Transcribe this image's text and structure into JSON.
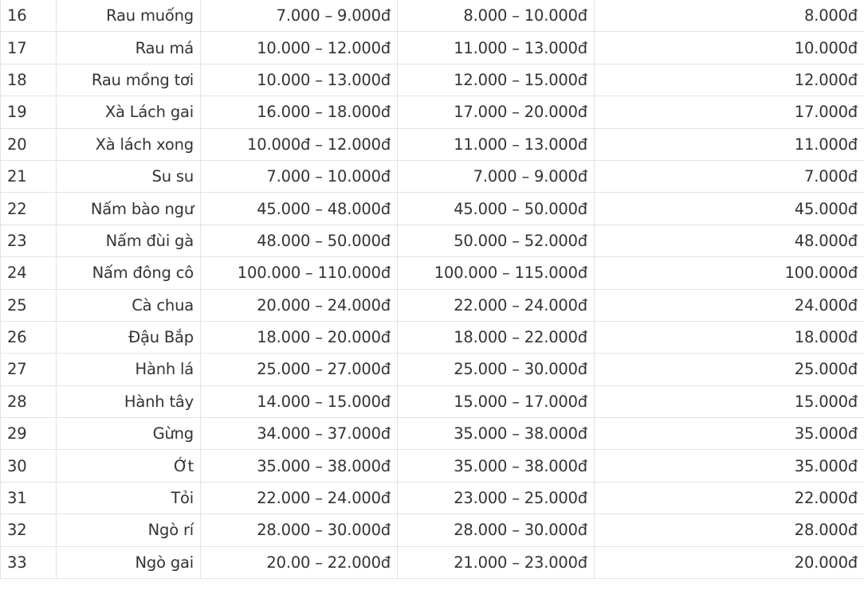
{
  "table": {
    "rows": [
      {
        "no": "16",
        "name": "Rau muống",
        "p1": "7.000 – 9.000đ",
        "p2": "8.000 – 10.000đ",
        "p3": "8.000đ"
      },
      {
        "no": "17",
        "name": "Rau má",
        "p1": "10.000 – 12.000đ",
        "p2": "11.000 – 13.000đ",
        "p3": "10.000đ"
      },
      {
        "no": "18",
        "name": "Rau mồng tơi",
        "p1": "10.000 – 13.000đ",
        "p2": "12.000 – 15.000đ",
        "p3": "12.000đ"
      },
      {
        "no": "19",
        "name": "Xà Lách gai",
        "p1": "16.000 – 18.000đ",
        "p2": "17.000 – 20.000đ",
        "p3": "17.000đ"
      },
      {
        "no": "20",
        "name": "Xà lách xong",
        "p1": "10.000đ – 12.000đ",
        "p2": "11.000 – 13.000đ",
        "p3": "11.000đ"
      },
      {
        "no": "21",
        "name": "Su su",
        "p1": "7.000 – 10.000đ",
        "p2": "7.000 – 9.000đ",
        "p3": "7.000đ"
      },
      {
        "no": "22",
        "name": "Nấm bào ngư",
        "p1": "45.000 – 48.000đ",
        "p2": "45.000 – 50.000đ",
        "p3": "45.000đ"
      },
      {
        "no": "23",
        "name": "Nấm đùi gà",
        "p1": "48.000 – 50.000đ",
        "p2": "50.000 – 52.000đ",
        "p3": "48.000đ"
      },
      {
        "no": "24",
        "name": "Nấm đông cô",
        "p1": "100.000 – 110.000đ",
        "p2": "100.000 – 115.000đ",
        "p3": "100.000đ"
      },
      {
        "no": "25",
        "name": "Cà chua",
        "p1": "20.000 – 24.000đ",
        "p2": "22.000 – 24.000đ",
        "p3": "24.000đ"
      },
      {
        "no": "26",
        "name": "Đậu Bắp",
        "p1": "18.000 – 20.000đ",
        "p2": "18.000 – 22.000đ",
        "p3": "18.000đ"
      },
      {
        "no": "27",
        "name": "Hành lá",
        "p1": "25.000 – 27.000đ",
        "p2": "25.000 – 30.000đ",
        "p3": "25.000đ"
      },
      {
        "no": "28",
        "name": "Hành tây",
        "p1": "14.000 – 15.000đ",
        "p2": "15.000 – 17.000đ",
        "p3": "15.000đ"
      },
      {
        "no": "29",
        "name": "Gừng",
        "p1": "34.000 – 37.000đ",
        "p2": "35.000 – 38.000đ",
        "p3": "35.000đ"
      },
      {
        "no": "30",
        "name": "Ớt",
        "p1": "35.000 – 38.000đ",
        "p2": "35.000 – 38.000đ",
        "p3": "35.000đ"
      },
      {
        "no": "31",
        "name": "Tỏi",
        "p1": "22.000 – 24.000đ",
        "p2": "23.000 – 25.000đ",
        "p3": "22.000đ"
      },
      {
        "no": "32",
        "name": "Ngò rí",
        "p1": "28.000 – 30.000đ",
        "p2": "28.000 – 30.000đ",
        "p3": "28.000đ"
      },
      {
        "no": "33",
        "name": "Ngò gai",
        "p1": "20.00 – 22.000đ",
        "p2": "21.000 – 23.000đ",
        "p3": "20.000đ"
      }
    ]
  },
  "colors": {
    "text": "#333333",
    "border": "#e3e3e3",
    "background": "#ffffff"
  }
}
